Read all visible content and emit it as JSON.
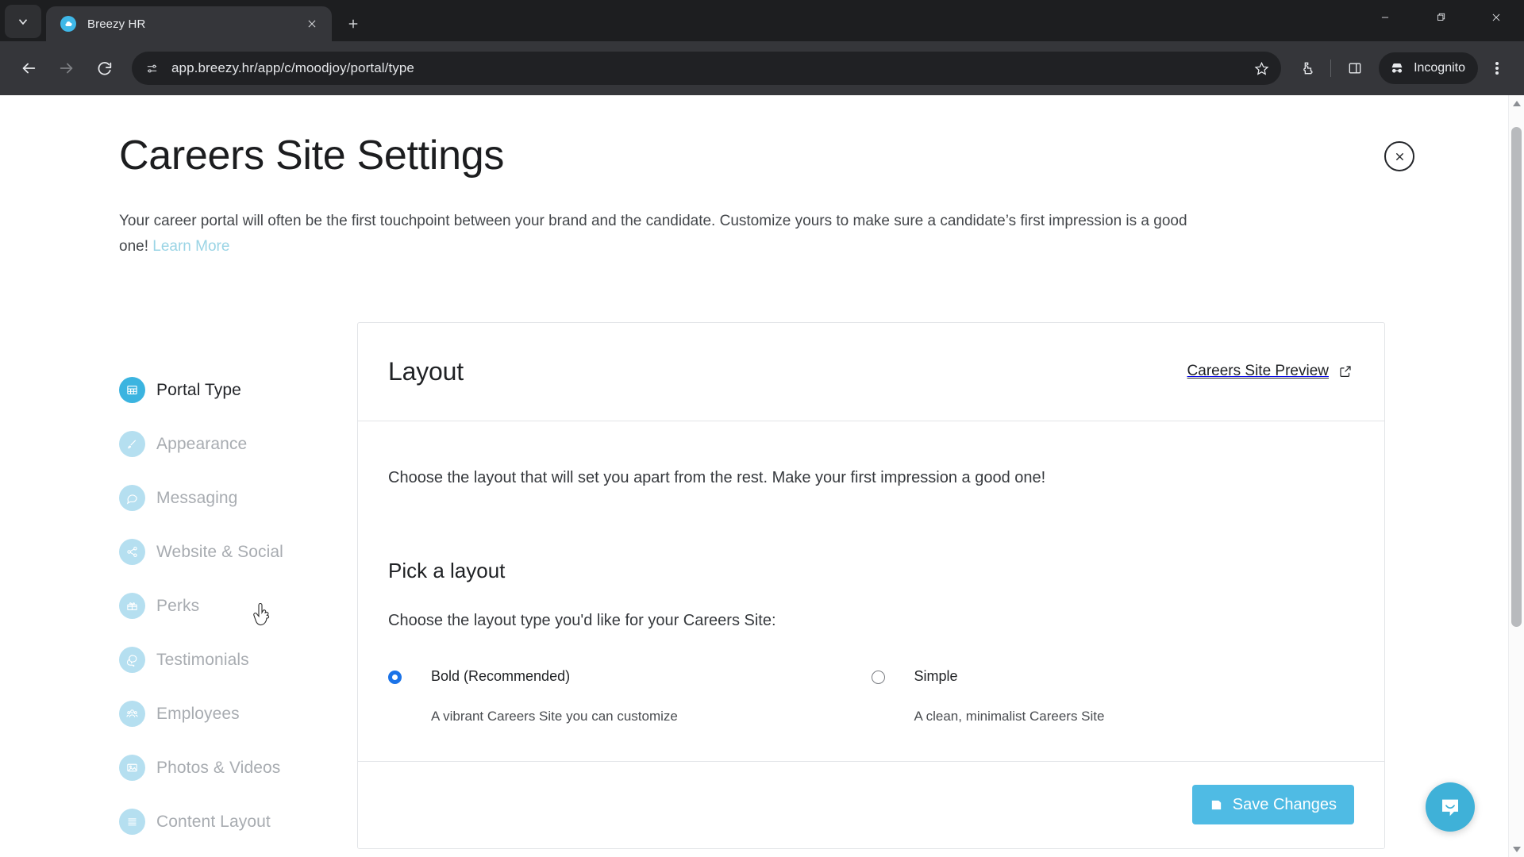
{
  "browser": {
    "tab": {
      "title": "Breezy HR",
      "favicon": "cloud-icon"
    },
    "tab_search_icon": "chevron-down-icon",
    "new_tab_label": "+",
    "window_controls": [
      "minimize",
      "maximize",
      "close"
    ],
    "nav": {
      "back": "back-arrow",
      "forward": "forward-arrow",
      "reload": "reload-icon"
    },
    "omnibox": {
      "url": "app.breezy.hr/app/c/moodjoy/portal/type",
      "site_info_icon": "page-settings-icon",
      "bookmark_icon": "star-icon"
    },
    "extensions_icon": "puzzle-icon",
    "side_panel_icon": "side-panel-icon",
    "profile": {
      "label": "Incognito",
      "icon": "incognito-icon"
    },
    "menu_icon": "kebab-menu-icon"
  },
  "page": {
    "title": "Careers Site Settings",
    "description_part1": "Your career portal will often be the first touchpoint between your brand and the candidate. Customize yours to make sure a candidate’s first impression is a good one!",
    "learn_more": "Learn More",
    "close_label": "close-modal"
  },
  "sidebar": {
    "items": [
      {
        "label": "Portal Type",
        "icon": "grid-icon",
        "active": true
      },
      {
        "label": "Appearance",
        "icon": "paintbrush-icon",
        "active": false
      },
      {
        "label": "Messaging",
        "icon": "chat-bubble-icon",
        "active": false
      },
      {
        "label": "Website & Social",
        "icon": "share-icon",
        "active": false
      },
      {
        "label": "Perks",
        "icon": "gift-icon",
        "active": false
      },
      {
        "label": "Testimonials",
        "icon": "quotes-icon",
        "active": false
      },
      {
        "label": "Employees",
        "icon": "people-icon",
        "active": false
      },
      {
        "label": "Photos & Videos",
        "icon": "image-icon",
        "active": false
      },
      {
        "label": "Content Layout",
        "icon": "list-icon",
        "active": false
      }
    ]
  },
  "card": {
    "heading": "Layout",
    "preview_link": "Careers Site Preview",
    "preview_icon": "external-link-icon",
    "lead": "Choose the layout that will set you apart from the rest. Make your first impression a good one!",
    "pick_title": "Pick a layout",
    "pick_sub": "Choose the layout type you'd like for your Careers Site:",
    "options": [
      {
        "label": "Bold (Recommended)",
        "desc": "A vibrant Careers Site you can customize",
        "selected": true
      },
      {
        "label": "Simple",
        "desc": "A clean, minimalist Careers Site",
        "selected": false
      }
    ],
    "save_label": "Save Changes",
    "save_icon": "floppy-disk-icon"
  },
  "widgets": {
    "intercom_label": "intercom-messenger",
    "cursor": "pointer-hand-cursor"
  },
  "colors": {
    "accent": "#4fbbe4",
    "accent_active_icon": "#3bb4e0",
    "icon_muted": "#b5dff0",
    "link": "#9ad4e5",
    "radio_selected": "#1b73e8",
    "chrome_dark": "#35363a",
    "chrome_darker": "#202124"
  }
}
